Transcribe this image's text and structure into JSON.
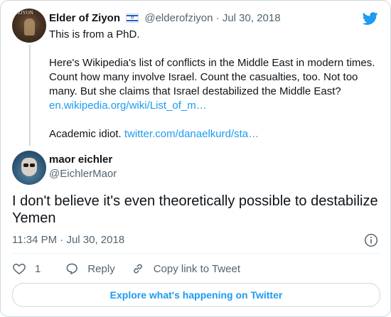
{
  "quoted_tweet": {
    "author_name": "Elder of Ziyon",
    "avatar_text": "ZIYON",
    "flag_icon": "israel-flag-icon",
    "handle": "@elderofziyon",
    "separator": "·",
    "date": "Jul 30, 2018",
    "lines": [
      "This is from a PhD.",
      "Here's Wikipedia's list of conflicts in the Middle East in modern times. Count how many involve Israel. Count the casualties, too. Not too many. But she claims that Israel destabilized the Middle East?",
      "en.wikipedia.org/wiki/List_of_m…",
      "Academic idiot.",
      "twitter.com/danaelkurd/sta…"
    ]
  },
  "tweet": {
    "author_name": "maor eichler",
    "handle": "@EichlerMaor",
    "text": "I don't believe it's even theoretically possible to destabilize Yemen",
    "time": "11:34 PM",
    "separator": "·",
    "date": "Jul 30, 2018"
  },
  "actions": {
    "like_count": "1",
    "reply_label": "Reply",
    "copy_label": "Copy link to Tweet"
  },
  "explore_label": "Explore what's happening on Twitter",
  "colors": {
    "accent": "#1d9bf0",
    "muted": "#536471",
    "border": "#cfd9de",
    "text": "#0f1419"
  },
  "icons": [
    "twitter-bird-icon",
    "info-icon",
    "heart-icon",
    "reply-icon",
    "link-icon"
  ]
}
